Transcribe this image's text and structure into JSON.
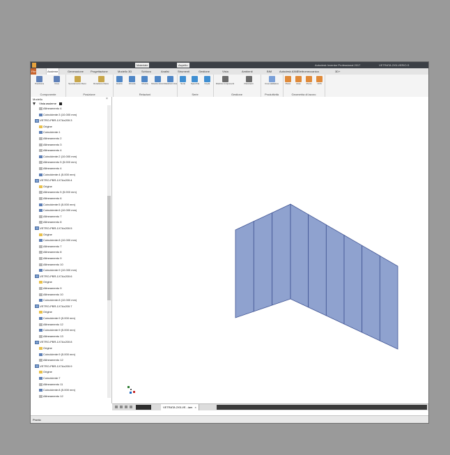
{
  "window": {
    "title": "Autodesk Inventor Professional 2017",
    "doc_title": "VETRATA 2X5-VERIO.S"
  },
  "quick_access": {
    "material": "Materiale",
    "appearance": "Aspetto"
  },
  "ribbon_tabs": [
    {
      "label": "File",
      "active": false,
      "file": true
    },
    {
      "label": "Assieme",
      "active": true
    },
    {
      "label": "Generazione",
      "active": false
    },
    {
      "label": "Progettazione",
      "active": false
    },
    {
      "label": "Modello 3D",
      "active": false
    },
    {
      "label": "Schizzo",
      "active": false
    },
    {
      "label": "Analisi",
      "active": false
    },
    {
      "label": "Strumenti",
      "active": false
    },
    {
      "label": "Gestione",
      "active": false
    },
    {
      "label": "Vista",
      "active": false
    },
    {
      "label": "Ambienti",
      "active": false
    },
    {
      "label": "BIM",
      "active": false
    },
    {
      "label": "Autodesk A360",
      "active": false
    },
    {
      "label": "Elettromeccanica",
      "active": false
    },
    {
      "label": "3D+",
      "active": false
    }
  ],
  "ribbon": {
    "groups": [
      {
        "label": "Componente",
        "buttons": [
          "Posiziona",
          "Crea"
        ]
      },
      {
        "label": "Posizione",
        "buttons": [
          "Spostamento libero",
          "Rotazione libera"
        ]
      },
      {
        "label": "Relazioni",
        "buttons": [
          "Giunto",
          "Vincola",
          "Mostra",
          "Mostra vincoli",
          "Relazioni triste"
        ]
      },
      {
        "label": "Serie",
        "buttons": [
          "Serie",
          "Specchia",
          "Copia"
        ]
      },
      {
        "label": "Gestione",
        "buttons": [
          "Distinta componenti",
          "Parametri"
        ]
      },
      {
        "label": "Produttività",
        "buttons": [
          "Crea saldatura"
        ]
      },
      {
        "label": "Geometria di lavoro",
        "buttons": [
          "Piano",
          "Asse",
          "Punto",
          "UCS"
        ]
      }
    ]
  },
  "model_panel": {
    "title": "Modello",
    "view_selector": "Vista assieme",
    "tree": [
      {
        "label": "Allineamento 4",
        "icon": "axis",
        "indent": 2
      },
      {
        "label": "Coincidente:3 (10.000 mm)",
        "icon": "sketch",
        "indent": 2
      },
      {
        "label": "VETRO-PBR-1X7Ax200:3",
        "icon": "part",
        "indent": 1
      },
      {
        "label": "Origine",
        "icon": "folder",
        "indent": 2
      },
      {
        "label": "Coincidente:1",
        "icon": "sketch",
        "indent": 2
      },
      {
        "label": "Allineamento 2",
        "icon": "axis",
        "indent": 2
      },
      {
        "label": "Allineamento 3",
        "icon": "axis",
        "indent": 2
      },
      {
        "label": "Allineamento 4",
        "icon": "axis",
        "indent": 2
      },
      {
        "label": "Coincidente:2 (10.000 mm)",
        "icon": "sketch",
        "indent": 2
      },
      {
        "label": "Allineamento 5 (5.000 mm)",
        "icon": "axis",
        "indent": 2
      },
      {
        "label": "Allineamento 4",
        "icon": "axis",
        "indent": 2
      },
      {
        "label": "Coincidente:4 (5.000 mm)",
        "icon": "sketch",
        "indent": 2
      },
      {
        "label": "VETRO-PBR-1X7Ax200:4",
        "icon": "part",
        "indent": 1
      },
      {
        "label": "Origine",
        "icon": "folder",
        "indent": 2
      },
      {
        "label": "Allineamento 5 (5.000 mm)",
        "icon": "axis",
        "indent": 2
      },
      {
        "label": "Allineamento 6",
        "icon": "axis",
        "indent": 2
      },
      {
        "label": "Coincidente:5 (5.000 mm)",
        "icon": "sketch",
        "indent": 2
      },
      {
        "label": "Coincidente:6 (10.000 mm)",
        "icon": "sketch",
        "indent": 2
      },
      {
        "label": "Allineamento 7",
        "icon": "axis",
        "indent": 2
      },
      {
        "label": "Allineamento 8",
        "icon": "axis",
        "indent": 2
      },
      {
        "label": "VETRO-PBR-1X7Ax200:5",
        "icon": "part",
        "indent": 1
      },
      {
        "label": "Origine",
        "icon": "folder",
        "indent": 2
      },
      {
        "label": "Coincidente:8 (10.000 mm)",
        "icon": "sketch",
        "indent": 2
      },
      {
        "label": "Allineamento 7",
        "icon": "axis",
        "indent": 2
      },
      {
        "label": "Allineamento 8",
        "icon": "axis",
        "indent": 2
      },
      {
        "label": "Allineamento 9",
        "icon": "axis",
        "indent": 2
      },
      {
        "label": "Allineamento 10",
        "icon": "axis",
        "indent": 2
      },
      {
        "label": "Coincidente:9 (10.000 mm)",
        "icon": "sketch",
        "indent": 2
      },
      {
        "label": "VETRO-PBR-1X7Ax200:6",
        "icon": "part",
        "indent": 1
      },
      {
        "label": "Origine",
        "icon": "folder",
        "indent": 2
      },
      {
        "label": "Allineamento 9",
        "icon": "axis",
        "indent": 2
      },
      {
        "label": "Allineamento 10",
        "icon": "axis",
        "indent": 2
      },
      {
        "label": "Coincidente:8 (10.000 mm)",
        "icon": "sketch",
        "indent": 2
      },
      {
        "label": "VETRO-PBR-1X7Ax200:7",
        "icon": "part",
        "indent": 1
      },
      {
        "label": "Origine",
        "icon": "folder",
        "indent": 2
      },
      {
        "label": "Coincidente:9 (5.000 mm)",
        "icon": "sketch",
        "indent": 2
      },
      {
        "label": "Allineamento 12",
        "icon": "axis",
        "indent": 2
      },
      {
        "label": "Coincidente:9 (5.000 mm)",
        "icon": "sketch",
        "indent": 2
      },
      {
        "label": "Allineamento 13",
        "icon": "axis",
        "indent": 2
      },
      {
        "label": "VETRO-PBR-1X7Ax200:8",
        "icon": "part",
        "indent": 1
      },
      {
        "label": "Origine",
        "icon": "folder",
        "indent": 2
      },
      {
        "label": "Coincidente:9 (5.000 mm)",
        "icon": "sketch",
        "indent": 2
      },
      {
        "label": "Allineamento 12",
        "icon": "axis",
        "indent": 2
      },
      {
        "label": "VETRO-PBR-1X7Ax200:9",
        "icon": "part",
        "indent": 1
      },
      {
        "label": "Origine",
        "icon": "folder",
        "indent": 2
      },
      {
        "label": "Coincidente:7",
        "icon": "sketch",
        "indent": 2
      },
      {
        "label": "Allineamento 11",
        "icon": "axis",
        "indent": 2
      },
      {
        "label": "Coincidente:8 (5.000 mm)",
        "icon": "sketch",
        "indent": 2
      },
      {
        "label": "Allineamento 12",
        "icon": "axis",
        "indent": 2
      }
    ]
  },
  "document_tab": {
    "label": "VETRATA 2X5-VE...iam"
  },
  "status": {
    "text": "Pronto"
  },
  "colors": {
    "glass_fill": "#8fa2cf",
    "glass_edge": "#3f5393",
    "titlebar": "#3b3f45",
    "file_tab": "#c8632b"
  }
}
